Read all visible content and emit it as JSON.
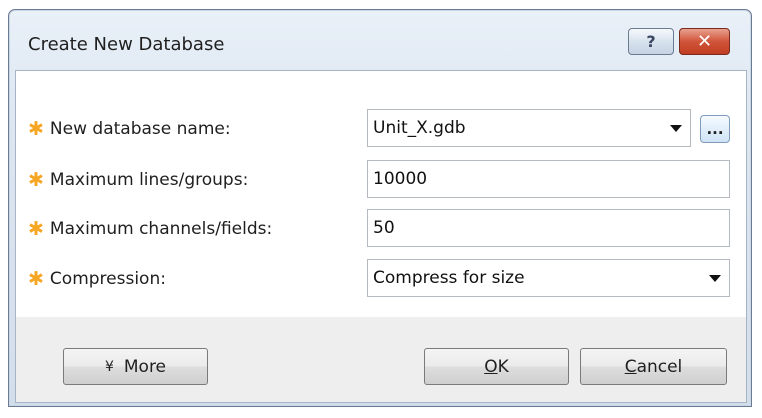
{
  "window": {
    "title": "Create New Database",
    "help_label": "?",
    "close_label": "✕"
  },
  "form": {
    "rows": [
      {
        "label": "New database name:",
        "value": "Unit_X.gdb"
      },
      {
        "label": "Maximum lines/groups:",
        "value": "10000"
      },
      {
        "label": "Maximum channels/fields:",
        "value": "50"
      },
      {
        "label": "Compression:",
        "value": "Compress for size"
      }
    ],
    "required_marker": "✱",
    "browse_label": "..."
  },
  "buttons": {
    "more_label": "More",
    "more_icon": "¥",
    "ok_prefix": "",
    "ok_mnemonic": "O",
    "ok_rest": "K",
    "cancel_mnemonic": "C",
    "cancel_rest": "ancel"
  }
}
